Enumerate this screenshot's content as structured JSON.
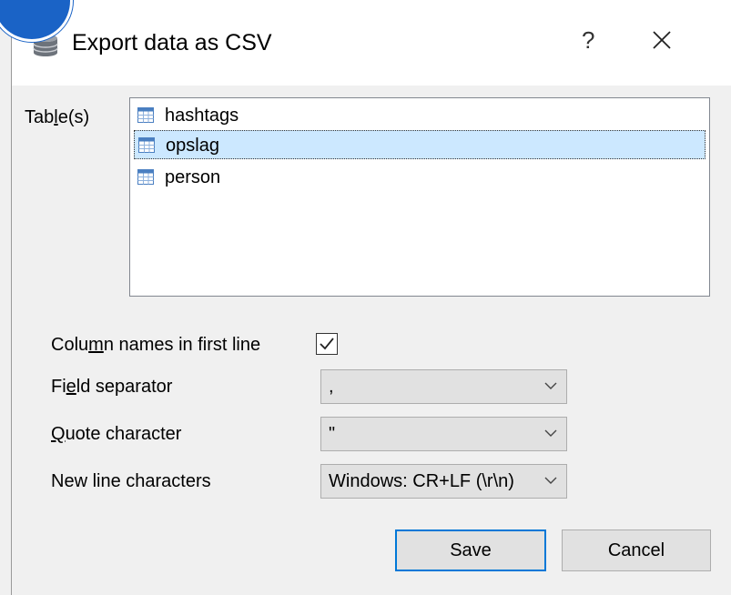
{
  "window": {
    "title": "Export data as CSV",
    "help_label": "?"
  },
  "tables": {
    "label_pre": "Tab",
    "label_mn": "l",
    "label_post": "e(s)",
    "items": [
      {
        "label": "hashtags",
        "selected": false
      },
      {
        "label": "opslag",
        "selected": true
      },
      {
        "label": "person",
        "selected": false
      }
    ]
  },
  "options": {
    "column_names": {
      "label_pre": "Colu",
      "label_mn": "m",
      "label_post": "n names in first line",
      "checked": true
    },
    "field_separator": {
      "label_pre": "Fi",
      "label_mn": "e",
      "label_post": "ld separator",
      "value": ","
    },
    "quote_character": {
      "label_pre": "",
      "label_mn": "Q",
      "label_post": "uote character",
      "value": "\""
    },
    "new_line": {
      "label": "New line characters",
      "value": "Windows: CR+LF (\\r\\n)"
    }
  },
  "buttons": {
    "save": "Save",
    "cancel": "Cancel"
  },
  "colors": {
    "accent": "#0078d7",
    "selection": "#cce8ff",
    "dialog_bg": "#f0f0f0",
    "badge": "#1a63c6"
  }
}
